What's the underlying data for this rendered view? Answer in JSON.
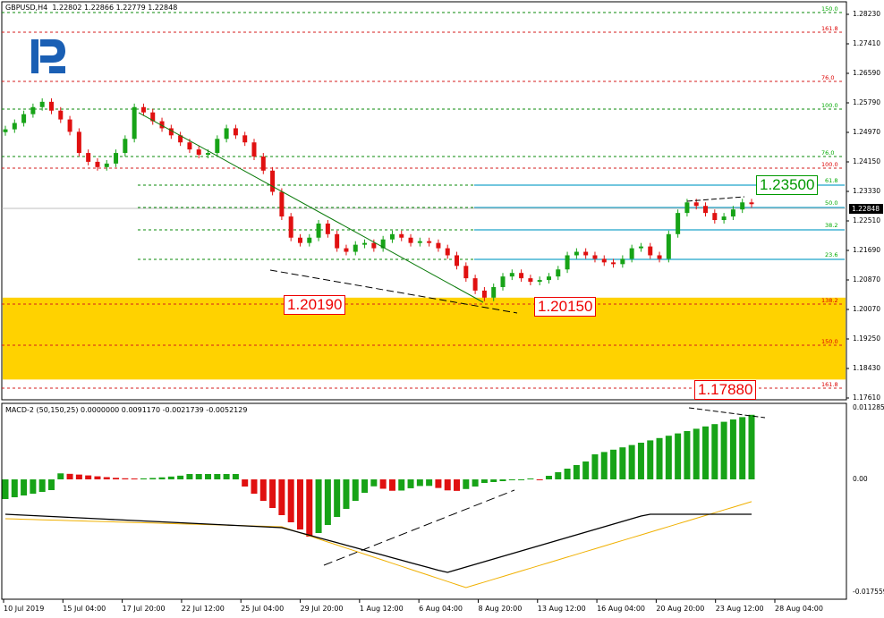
{
  "header": {
    "symbol_line": "GBPUSD,H4  1.22802 1.22866 1.22779 1.22848"
  },
  "macd_header": "MACD-2 (50,150,25) 0.0000000 0.0091170 -0.0021739 -0.0052129",
  "current_price": "1.22848",
  "price_axis": [
    "1.28230",
    "1.27410",
    "1.26590",
    "1.25790",
    "1.24970",
    "1.24150",
    "1.23330",
    "1.22510",
    "1.21690",
    "1.20870",
    "1.20070",
    "1.19250",
    "1.18430",
    "1.17610"
  ],
  "macd_axis": [
    "0.0112857",
    "0.00",
    "-0.017559"
  ],
  "date_axis": [
    "10 Jul 2019",
    "15 Jul 04:00",
    "17 Jul 20:00",
    "22 Jul 12:00",
    "25 Jul 04:00",
    "29 Jul 20:00",
    "1 Aug 12:00",
    "6 Aug 04:00",
    "8 Aug 20:00",
    "13 Aug 12:00",
    "16 Aug 04:00",
    "20 Aug 20:00",
    "23 Aug 12:00",
    "28 Aug 04:00"
  ],
  "fib_levels_left": [
    "150.0",
    "161.8",
    "76.0",
    "100.0",
    "76.0",
    "100.0",
    "138.2",
    "150.0",
    "161.8"
  ],
  "fib_levels_right": [
    "61.8",
    "50.0",
    "38.2",
    "23.6"
  ],
  "callouts": {
    "target_up": "1.23500",
    "support_1": "1.20190",
    "support_2": "1.20150",
    "target_down": "1.17880"
  },
  "colors": {
    "bull": "#17a317",
    "bear": "#e01010",
    "zone": "#ffd200",
    "fib_green": "#0a8a0a",
    "fib_red": "#d41c1c",
    "fib_cyan": "#1fa5c9",
    "macd_signal_up": "#f0b000",
    "macd_main": "#000000"
  },
  "chart_data": {
    "type": "candlestick",
    "symbol": "GBPUSD",
    "timeframe": "H4",
    "ylim": [
      1.1761,
      1.2823
    ],
    "closes": [
      1.2497,
      1.2515,
      1.254,
      1.256,
      1.2575,
      1.255,
      1.2525,
      1.249,
      1.243,
      1.2405,
      1.239,
      1.24,
      1.243,
      1.247,
      1.256,
      1.2545,
      1.252,
      1.25,
      1.248,
      1.246,
      1.244,
      1.2425,
      1.243,
      1.247,
      1.25,
      1.248,
      1.246,
      1.242,
      1.238,
      1.232,
      1.225,
      1.219,
      1.2175,
      1.219,
      1.223,
      1.22,
      1.216,
      1.215,
      1.217,
      1.2175,
      1.216,
      1.2185,
      1.22,
      1.219,
      1.2175,
      1.218,
      1.2175,
      1.216,
      1.214,
      1.211,
      1.2075,
      1.204,
      1.202,
      1.205,
      1.208,
      1.209,
      1.2075,
      1.2065,
      1.207,
      1.208,
      1.21,
      1.214,
      1.215,
      1.214,
      1.213,
      1.212,
      1.2115,
      1.213,
      1.216,
      1.2165,
      1.214,
      1.213,
      1.22,
      1.226,
      1.229,
      1.228,
      1.226,
      1.224,
      1.225,
      1.227,
      1.229,
      1.2285
    ],
    "fib_up_levels": [
      {
        "ratio": "61.8",
        "price": 1.235
      },
      {
        "ratio": "50.0",
        "price": 1.2285
      },
      {
        "ratio": "38.2",
        "price": 1.2228
      },
      {
        "ratio": "23.6",
        "price": 1.216
      }
    ],
    "support_zone": [
      1.1788,
      1.202
    ],
    "macd_range": [
      -0.017559,
      0.0112857
    ]
  }
}
